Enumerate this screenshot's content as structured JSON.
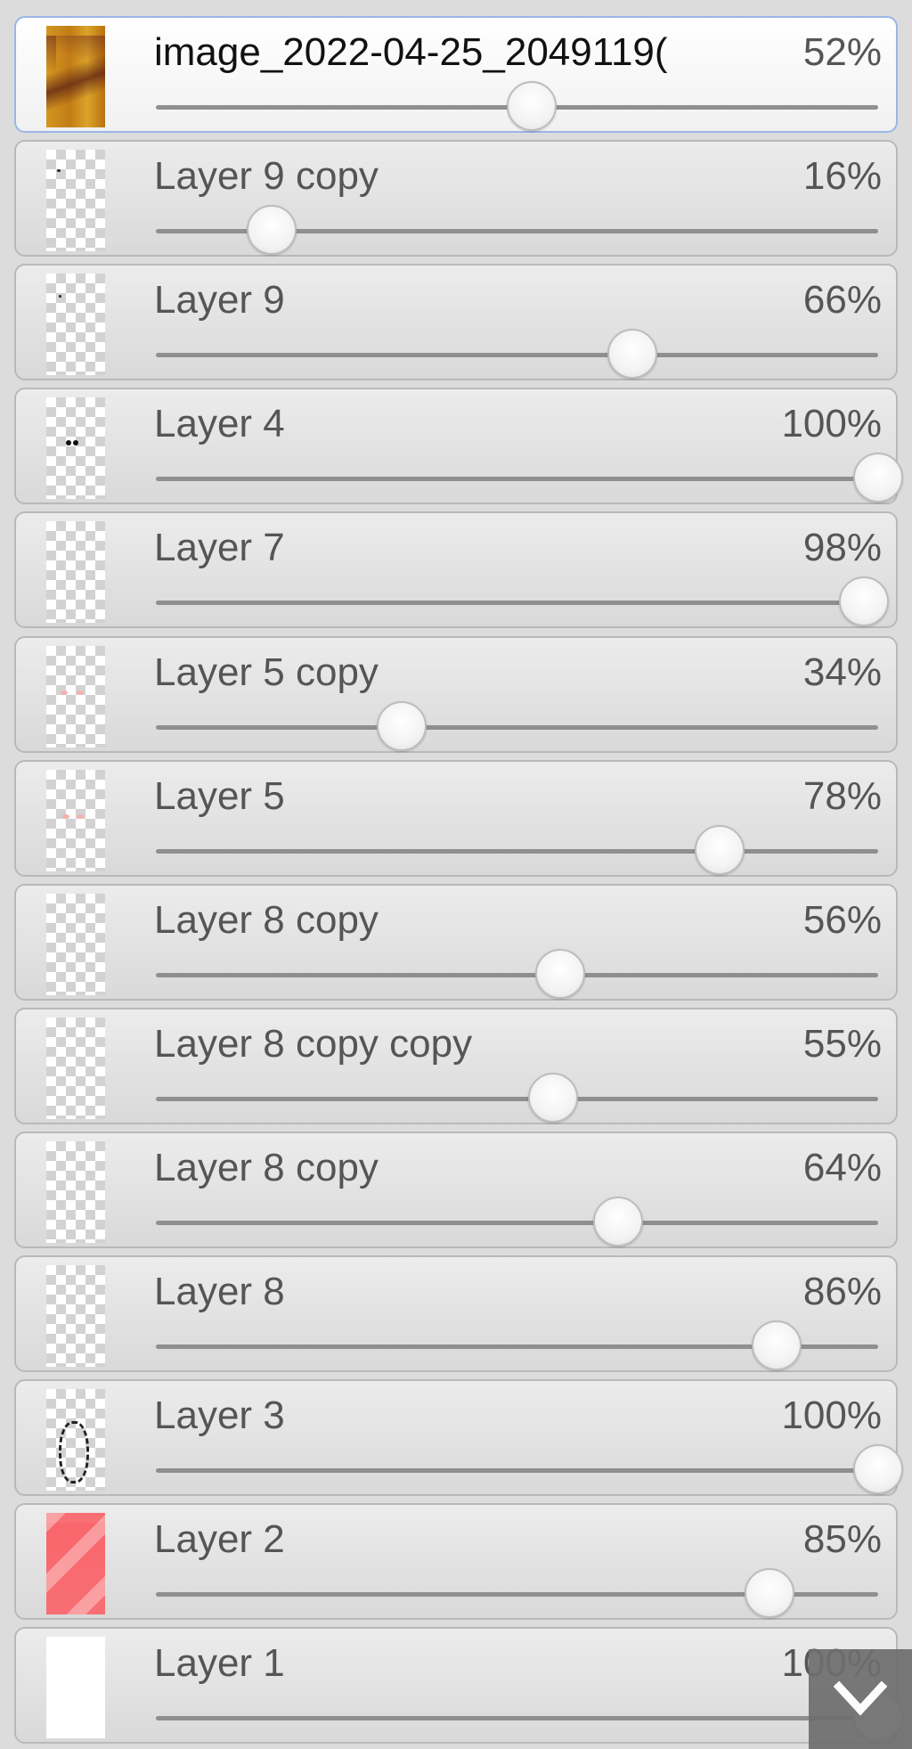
{
  "layers": [
    {
      "name": "image_2022-04-25_2049119(",
      "opacity": "52%",
      "value": 0.52,
      "thumb": "photo",
      "active": true
    },
    {
      "name": "Layer 9 copy",
      "opacity": "16%",
      "value": 0.16,
      "thumb": "transparent"
    },
    {
      "name": "Layer 9",
      "opacity": "66%",
      "value": 0.66,
      "thumb": "transparent"
    },
    {
      "name": "Layer 4",
      "opacity": "100%",
      "value": 1.0,
      "thumb": "transparent"
    },
    {
      "name": "Layer 7",
      "opacity": "98%",
      "value": 0.98,
      "thumb": "transparent"
    },
    {
      "name": "Layer 5 copy",
      "opacity": "34%",
      "value": 0.34,
      "thumb": "transparent"
    },
    {
      "name": "Layer 5",
      "opacity": "78%",
      "value": 0.78,
      "thumb": "transparent"
    },
    {
      "name": "Layer 8 copy",
      "opacity": "56%",
      "value": 0.56,
      "thumb": "transparent"
    },
    {
      "name": "Layer 8 copy copy",
      "opacity": "55%",
      "value": 0.55,
      "thumb": "transparent"
    },
    {
      "name": "Layer 8 copy",
      "opacity": "64%",
      "value": 0.64,
      "thumb": "transparent"
    },
    {
      "name": "Layer 8",
      "opacity": "86%",
      "value": 0.86,
      "thumb": "transparent"
    },
    {
      "name": "Layer 3",
      "opacity": "100%",
      "value": 1.0,
      "thumb": "transparent"
    },
    {
      "name": "Layer 2",
      "opacity": "85%",
      "value": 0.85,
      "thumb": "pink"
    },
    {
      "name": "Layer 1",
      "opacity": "100%",
      "value": 1.0,
      "thumb": "white"
    }
  ],
  "scroll_button": {
    "icon": "chevron-down-icon"
  },
  "colors": {
    "active_border": "#9ab6e6",
    "panel_bg": "#dcdcdc",
    "text": "#555555"
  }
}
